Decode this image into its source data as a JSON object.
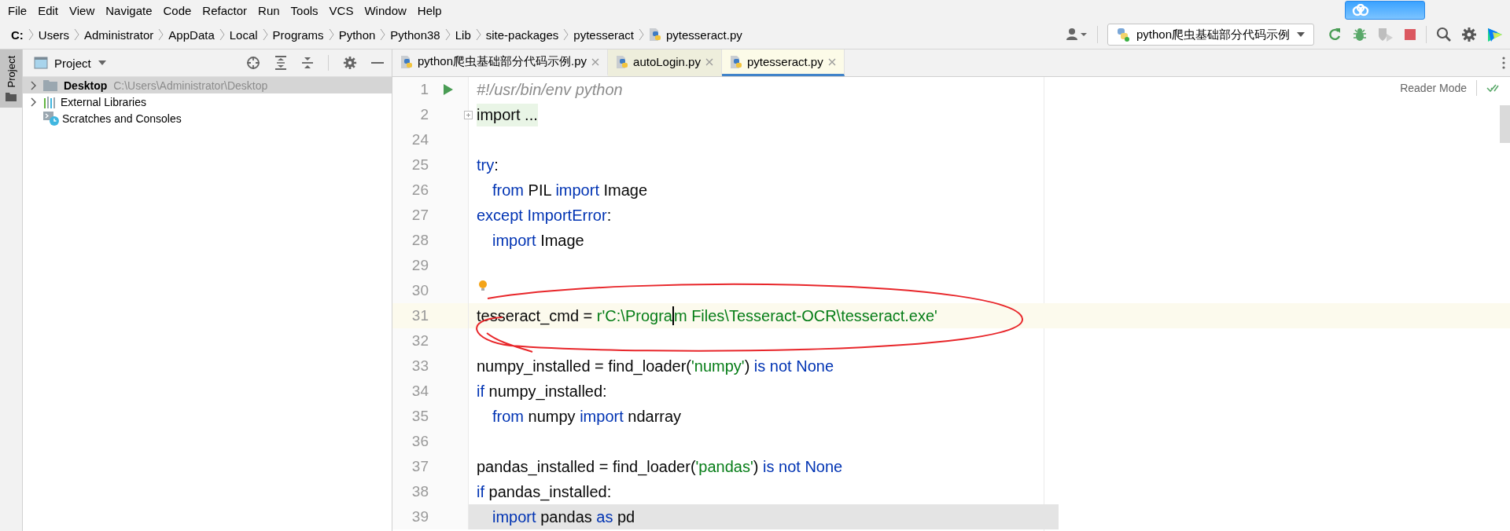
{
  "menu": [
    "File",
    "Edit",
    "View",
    "Navigate",
    "Code",
    "Refactor",
    "Run",
    "Tools",
    "VCS",
    "Window",
    "Help"
  ],
  "breadcrumbs": [
    "C:",
    "Users",
    "Administrator",
    "AppData",
    "Local",
    "Programs",
    "Python",
    "Python38",
    "Lib",
    "site-packages",
    "pytesseract",
    "pytesseract.py"
  ],
  "run_config": {
    "label": "python爬虫基础部分代码示例"
  },
  "toolbar": [
    {
      "kind": "rerun",
      "disabled": false
    },
    {
      "kind": "debug",
      "disabled": false
    },
    {
      "kind": "coverage",
      "disabled": true
    },
    {
      "kind": "stop",
      "disabled": false
    }
  ],
  "side_tab": {
    "label": "Project",
    "selected": true
  },
  "project": {
    "title": "Project",
    "items": [
      {
        "label": "Desktop",
        "path": "C:\\Users\\Administrator\\Desktop",
        "kind": "folder",
        "expandable": true,
        "selected": true
      },
      {
        "label": "External Libraries",
        "kind": "libraries",
        "expandable": true,
        "selected": false
      },
      {
        "label": "Scratches and Consoles",
        "kind": "scratches",
        "expandable": false,
        "selected": false
      }
    ]
  },
  "tabs": [
    {
      "label": "python爬虫基础部分代码示例.py",
      "selected": false,
      "color": "#f2f2f2"
    },
    {
      "label": "autoLogin.py",
      "selected": false,
      "color": "#eeeedc"
    },
    {
      "label": "pytesseract.py",
      "selected": true,
      "color": "#fcfbe8"
    }
  ],
  "editor": {
    "reader_mode": "Reader Mode",
    "lines": [
      {
        "number": "1",
        "runnable": true,
        "tokens": [
          {
            "kind": "comment",
            "text": "#!/usr/bin/env python"
          }
        ]
      },
      {
        "number": "2",
        "folded": true,
        "tokens": [
          {
            "kind": "plain",
            "text": "import ..."
          }
        ]
      },
      {
        "number": "24"
      },
      {
        "number": "25",
        "tokens": [
          {
            "kind": "keyword",
            "text": "try"
          },
          {
            "kind": "plain",
            "text": ":"
          }
        ]
      },
      {
        "number": "26",
        "indented": true,
        "tokens": [
          {
            "kind": "keyword",
            "text": "from"
          },
          {
            "kind": "plain",
            "text": " PIL "
          },
          {
            "kind": "keyword",
            "text": "import"
          },
          {
            "kind": "plain",
            "text": " Image"
          }
        ]
      },
      {
        "number": "27",
        "tokens": [
          {
            "kind": "keyword",
            "text": "except"
          },
          {
            "kind": "keyword",
            "text": " ImportError"
          },
          {
            "kind": "plain",
            "text": ":"
          }
        ]
      },
      {
        "number": "28",
        "indented": true,
        "tokens": [
          {
            "kind": "keyword",
            "text": "import"
          },
          {
            "kind": "plain",
            "text": " Image"
          }
        ]
      },
      {
        "number": "29"
      },
      {
        "number": "30",
        "bulb": true
      },
      {
        "number": "31",
        "current": true,
        "tokens": [
          {
            "kind": "plain",
            "text": "tesseract_cmd = "
          },
          {
            "kind": "string",
            "text": "r'C:\\Progra"
          },
          {
            "kind": "caret"
          },
          {
            "kind": "string",
            "text": "m Files\\Tesseract-OCR\\tesseract.exe'"
          }
        ]
      },
      {
        "number": "32"
      },
      {
        "number": "33",
        "tokens": [
          {
            "kind": "plain",
            "text": "numpy_installed = find_loader("
          },
          {
            "kind": "string",
            "text": "'numpy'"
          },
          {
            "kind": "plain",
            "text": ") "
          },
          {
            "kind": "keyword",
            "text": "is not None"
          }
        ]
      },
      {
        "number": "34",
        "tokens": [
          {
            "kind": "keyword",
            "text": "if"
          },
          {
            "kind": "plain",
            "text": " numpy_installed:"
          }
        ]
      },
      {
        "number": "35",
        "indented": true,
        "tokens": [
          {
            "kind": "keyword",
            "text": "from"
          },
          {
            "kind": "plain",
            "text": " numpy "
          },
          {
            "kind": "keyword",
            "text": "import"
          },
          {
            "kind": "plain",
            "text": " ndarray"
          }
        ]
      },
      {
        "number": "36"
      },
      {
        "number": "37",
        "tokens": [
          {
            "kind": "plain",
            "text": "pandas_installed = find_loader("
          },
          {
            "kind": "string",
            "text": "'pandas'"
          },
          {
            "kind": "plain",
            "text": ") "
          },
          {
            "kind": "keyword",
            "text": "is not None"
          }
        ]
      },
      {
        "number": "38",
        "tokens": [
          {
            "kind": "keyword",
            "text": "if"
          },
          {
            "kind": "plain",
            "text": " pandas_installed:"
          }
        ]
      },
      {
        "number": "39",
        "indented": true,
        "shaded": true,
        "tokens": [
          {
            "kind": "keyword",
            "text": "import"
          },
          {
            "kind": "plain",
            "text": " pandas "
          },
          {
            "kind": "keyword",
            "text": "as"
          },
          {
            "kind": "plain",
            "text": " pd"
          }
        ]
      }
    ]
  }
}
